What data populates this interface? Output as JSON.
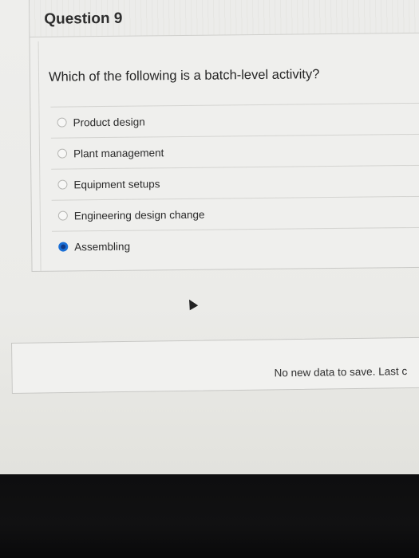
{
  "question": {
    "title": "Question 9",
    "prompt": "Which of the following is a batch-level activity?",
    "options": [
      {
        "label": "Product design",
        "selected": false
      },
      {
        "label": "Plant management",
        "selected": false
      },
      {
        "label": "Equipment setups",
        "selected": false
      },
      {
        "label": "Engineering design change",
        "selected": false
      },
      {
        "label": "Assembling",
        "selected": true
      }
    ]
  },
  "save_bar": {
    "status_text": "No new data to save. Last c"
  },
  "colors": {
    "selected_radio": "#1a6fd6",
    "screen_bezel": "#0e0e0f"
  }
}
